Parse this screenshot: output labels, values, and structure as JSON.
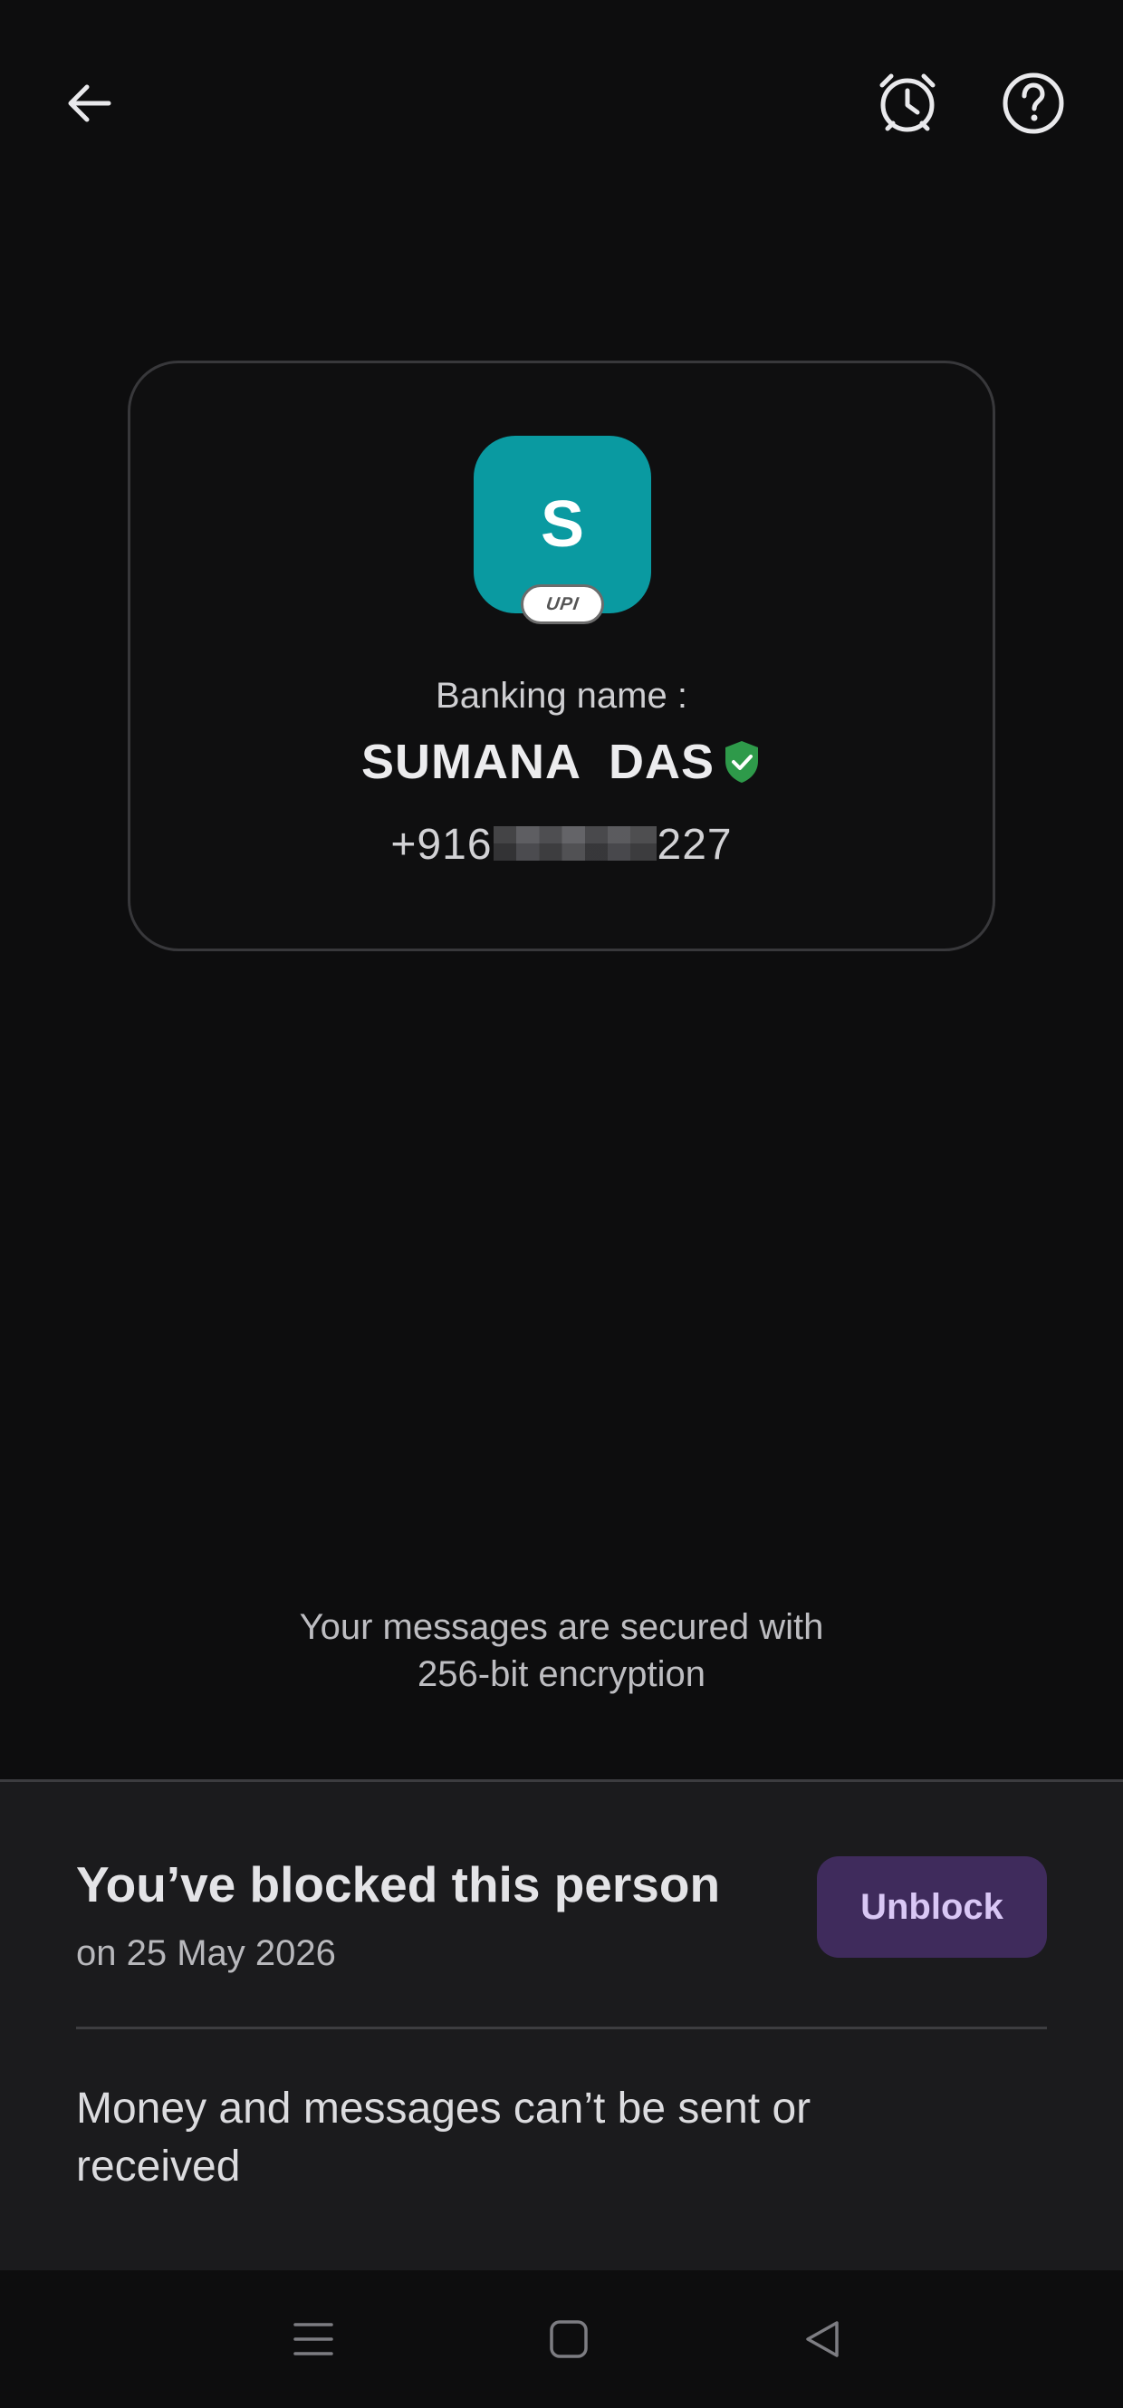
{
  "header": {
    "back_icon": "arrow-left-icon",
    "reminder_icon": "alarm-clock-icon",
    "help_icon": "help-circle-icon"
  },
  "contact": {
    "avatar_initial": "S",
    "avatar_color": "#0a9aa1",
    "badge": "UPI",
    "banking_label": "Banking name :",
    "name": "SUMANA  DAS",
    "verified_icon": "verified-shield-icon",
    "verified_color": "#2e9a4a",
    "phone_prefix": "+916",
    "phone_suffix": "227"
  },
  "security_message": {
    "line1": "Your messages are secured with",
    "line2": "256-bit encryption"
  },
  "blocked": {
    "title": "You’ve blocked this person",
    "date": "on 25 May 2026",
    "unblock_label": "Unblock",
    "accent_color": "#3f2b5c",
    "note": "Money and messages can’t be sent or received"
  },
  "navbar": {
    "menu_icon": "menu-icon",
    "home_icon": "home-square-icon",
    "back_icon": "back-triangle-icon"
  }
}
